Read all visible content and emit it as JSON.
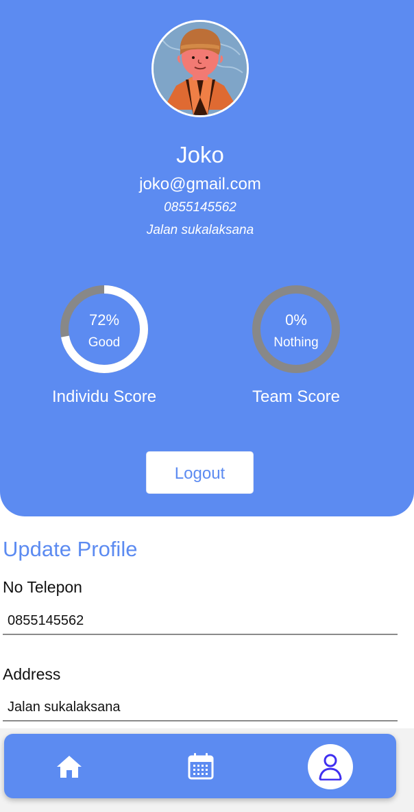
{
  "profile": {
    "name": "Joko",
    "email": "joko@gmail.com",
    "phone": "0855145562",
    "address": "Jalan sukalaksana"
  },
  "scores": [
    {
      "value": "72%",
      "percent": 72,
      "status": "Good",
      "label": "Individu Score"
    },
    {
      "value": "0%",
      "percent": 0,
      "status": "Nothing",
      "label": "Team Score"
    }
  ],
  "actions": {
    "logout_label": "Logout"
  },
  "update_profile": {
    "title": "Update Profile",
    "phone_label": "No Telepon",
    "phone_value": "0855145562",
    "address_label": "Address",
    "address_value": "Jalan sukalaksana"
  },
  "bottom_nav": {
    "items": [
      {
        "icon": "home-icon",
        "active": false
      },
      {
        "icon": "calendar-icon",
        "active": false
      },
      {
        "icon": "user-icon",
        "active": true
      }
    ]
  },
  "colors": {
    "primary": "#5c8bf1",
    "ring_fill": "#ffffff",
    "ring_track": "#888888"
  }
}
